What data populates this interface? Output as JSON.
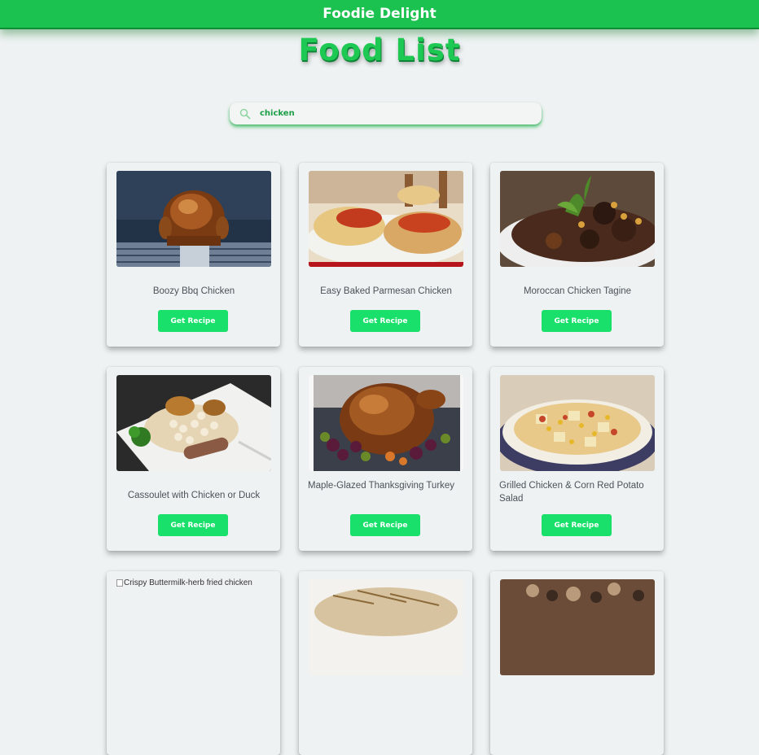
{
  "header": {
    "brand": "Foodie Delight"
  },
  "page": {
    "title": "Food List"
  },
  "search": {
    "value": "chicken",
    "icon": "search-icon"
  },
  "colors": {
    "accent": "#1cc24f",
    "button": "#19e06a",
    "title": "#1dc953"
  },
  "cards": [
    {
      "title": "Boozy Bbq Chicken",
      "button": "Get Recipe"
    },
    {
      "title": "Easy Baked Parmesan Chicken",
      "button": "Get Recipe"
    },
    {
      "title": "Moroccan Chicken Tagine",
      "button": "Get Recipe"
    },
    {
      "title": "Cassoulet with Chicken or Duck",
      "button": "Get Recipe"
    },
    {
      "title": "Maple-Glazed Thanksgiving Turkey",
      "button": "Get Recipe"
    },
    {
      "title": "Grilled Chicken & Corn Red Potato Salad",
      "button": "Get Recipe"
    },
    {
      "image_alt": "Crispy Buttermilk-herb fried chicken"
    },
    {},
    {}
  ]
}
